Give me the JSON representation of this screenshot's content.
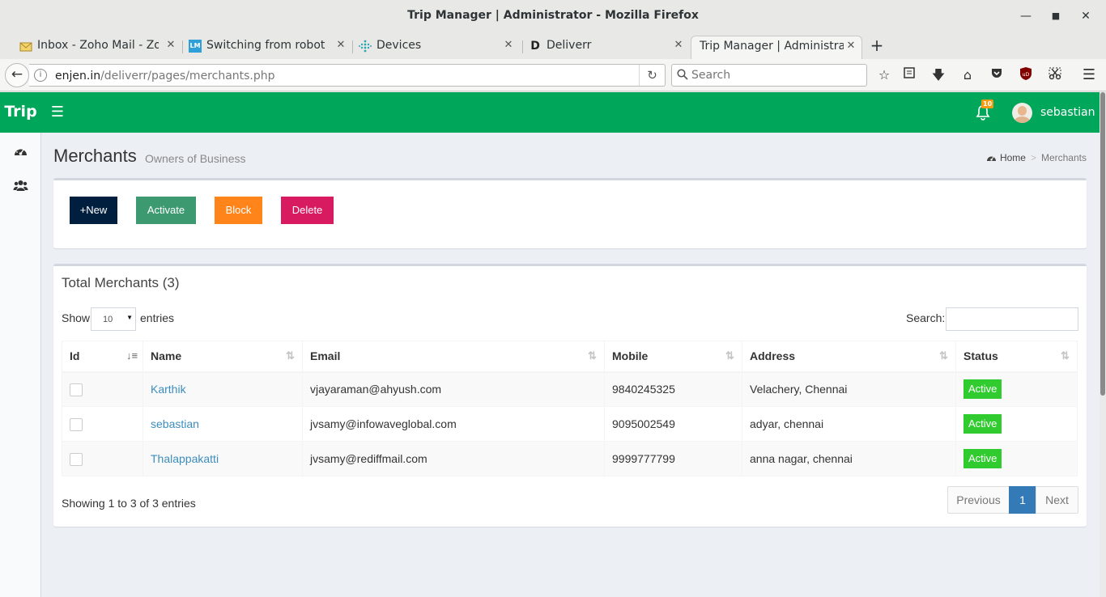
{
  "window": {
    "title": "Trip Manager | Administrator - Mozilla Firefox"
  },
  "tabs": [
    {
      "label": "Inbox - Zoho Mail - Zoho",
      "icon": "mail-icon"
    },
    {
      "label": "Switching from robot sy",
      "icon": "lm-icon",
      "icon_text": "LM"
    },
    {
      "label": "Devices",
      "icon": "dots-icon"
    },
    {
      "label": "Deliverr",
      "icon": "d-icon",
      "icon_text": "D"
    },
    {
      "label": "Trip Manager | Administrato",
      "icon": "none",
      "active": true
    }
  ],
  "navbar": {
    "url_host": "enjen.in",
    "url_path": "/deliverr/pages/merchants.php",
    "search_placeholder": "Search",
    "ublock_label": "uD"
  },
  "app": {
    "logo": "Trip",
    "notifications_count": "10",
    "username": "sebastian",
    "header_color": "#00a65a"
  },
  "page": {
    "title": "Merchants",
    "subtitle": "Owners of Business",
    "breadcrumb": {
      "home": "Home",
      "separator": ">",
      "current": "Merchants"
    }
  },
  "actions": {
    "new_label": "+New",
    "activate_label": "Activate",
    "block_label": "Block",
    "delete_label": "Delete"
  },
  "merchants": {
    "title": "Total Merchants (3)",
    "show_label": "Show",
    "page_length": "10",
    "entries_label": "entries",
    "search_label": "Search:",
    "columns": [
      "Id",
      "Name",
      "Email",
      "Mobile",
      "Address",
      "Status"
    ],
    "rows": [
      {
        "name": "Karthik",
        "email": "vjayaraman@ahyush.com",
        "mobile": "9840245325",
        "address": "Velachery, Chennai",
        "status": "Active"
      },
      {
        "name": "sebastian",
        "email": "jvsamy@infowaveglobal.com",
        "mobile": "9095002549",
        "address": "adyar, chennai",
        "status": "Active"
      },
      {
        "name": "Thalappakatti",
        "email": "jvsamy@rediffmail.com",
        "mobile": "9999777799",
        "address": "anna nagar, chennai",
        "status": "Active"
      }
    ],
    "info": "Showing 1 to 3 of 3 entries",
    "pagination": {
      "previous": "Previous",
      "current_page": "1",
      "next": "Next"
    }
  }
}
